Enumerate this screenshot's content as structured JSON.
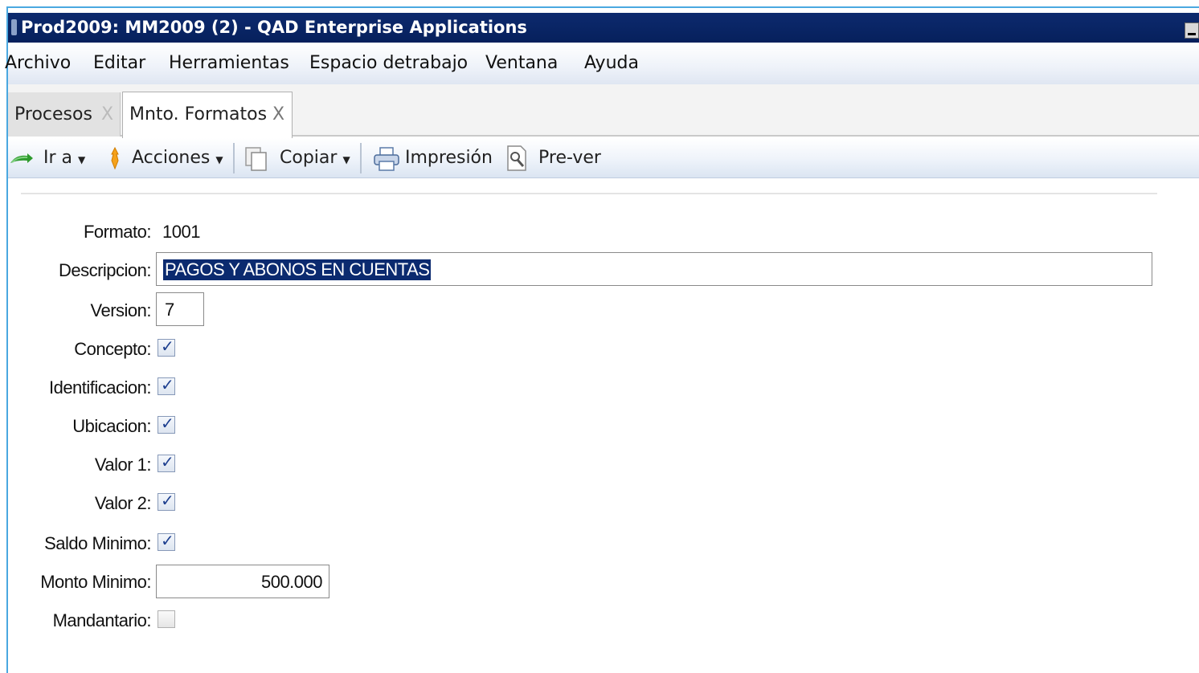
{
  "window": {
    "title": "Prod2009: MM2009 (2) - QAD Enterprise Applications"
  },
  "menu": [
    {
      "label": "Archivo"
    },
    {
      "label": "Editar"
    },
    {
      "label": "Herramientas"
    },
    {
      "label": "Espacio detrabajo"
    },
    {
      "label": "Ventana"
    },
    {
      "label": "Ayuda"
    }
  ],
  "tabs": [
    {
      "label": "Procesos",
      "close": "X",
      "active": false
    },
    {
      "label": "Mnto. Formatos",
      "close": "X",
      "active": true
    }
  ],
  "toolbar": {
    "goto_label": "Ir a",
    "actions_label": "Acciones",
    "copy_label": "Copiar",
    "print_label": "Impresión",
    "preview_label": "Pre-ver",
    "dropdown_glyph": "▼"
  },
  "form": {
    "formato": {
      "label": "Formato:",
      "value": "1001"
    },
    "descripcion": {
      "label": "Descripcion:",
      "value": "PAGOS Y ABONOS EN CUENTAS"
    },
    "version": {
      "label": "Version:",
      "value": "7"
    },
    "concepto": {
      "label": "Concepto:",
      "checked": true
    },
    "identificacion": {
      "label": "Identificacion:",
      "checked": true
    },
    "ubicacion": {
      "label": "Ubicacion:",
      "checked": true
    },
    "valor1": {
      "label": "Valor 1:",
      "checked": true
    },
    "valor2": {
      "label": "Valor 2:",
      "checked": true
    },
    "saldo_minimo": {
      "label": "Saldo Minimo:",
      "checked": true
    },
    "monto_minimo": {
      "label": "Monto Minimo:",
      "value": "500.000"
    },
    "mandantario": {
      "label": "Mandantario:",
      "checked": false
    }
  },
  "check_glyph": "✓",
  "colors": {
    "titlebar": "#0d2a6e",
    "selection": "#0b2a6f",
    "frame_accent": "#4aa8e0"
  },
  "icons": [
    "app-icon",
    "goto-icon",
    "actions-icon",
    "copy-icon",
    "print-icon",
    "preview-icon",
    "close-icon",
    "chevron-down-icon",
    "minimize-icon"
  ]
}
